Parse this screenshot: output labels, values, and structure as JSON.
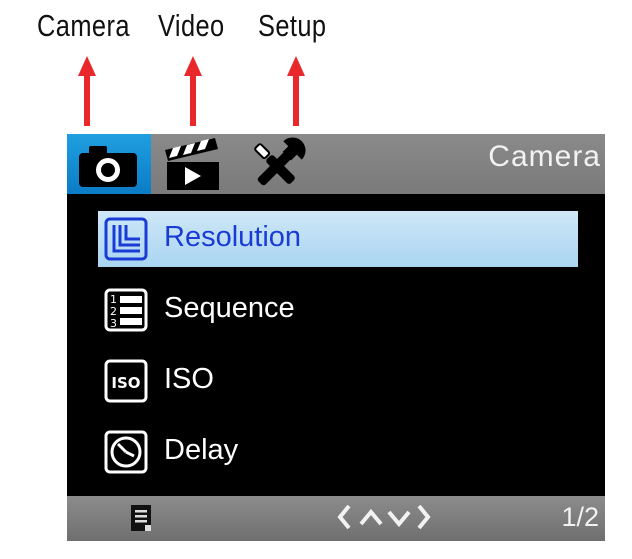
{
  "annotations": {
    "camera_label": "Camera",
    "video_label": "Video",
    "setup_label": "Setup",
    "arrow_color": "#e8282a"
  },
  "screen": {
    "active_mode_title": "Camera",
    "tabs": [
      {
        "id": "camera",
        "icon": "camera-icon",
        "active": true
      },
      {
        "id": "video",
        "icon": "clapperboard-icon",
        "active": false
      },
      {
        "id": "setup",
        "icon": "wrench-screwdriver-icon",
        "active": false
      }
    ],
    "accent_color": "#1a8fd8",
    "menu": [
      {
        "label": "Resolution",
        "icon": "resolution-icon",
        "selected": true
      },
      {
        "label": "Sequence",
        "icon": "sequence-icon",
        "selected": false
      },
      {
        "label": "ISO",
        "icon": "iso-icon",
        "selected": false
      },
      {
        "label": "Delay",
        "icon": "timer-icon",
        "selected": false
      }
    ],
    "footer": {
      "icon": "document-icon",
      "nav_glyphs": "<^v>",
      "page": "1/2"
    }
  }
}
